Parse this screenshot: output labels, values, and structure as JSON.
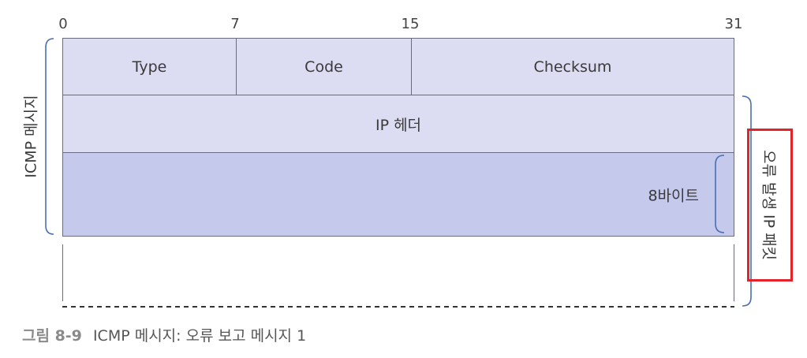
{
  "bit_markers": [
    "0",
    "7",
    "15",
    "31"
  ],
  "rows": {
    "type_label": "Type",
    "code_label": "Code",
    "checksum_label": "Checksum",
    "ip_header_label": "IP 헤더",
    "bytes_label": "8바이트"
  },
  "labels": {
    "icmp_message": "ICMP 메시지",
    "error_ip_packet": "오류 발생 IP 패킷"
  },
  "caption": {
    "figure_number": "그림 8-9",
    "text": "ICMP 메시지: 오류 보고 메시지 1"
  },
  "colors": {
    "header_fill": "#dcdcf2",
    "payload_fill": "#c5c9ec",
    "brace": "#4a6fb0",
    "highlight_border": "#e2242a"
  }
}
